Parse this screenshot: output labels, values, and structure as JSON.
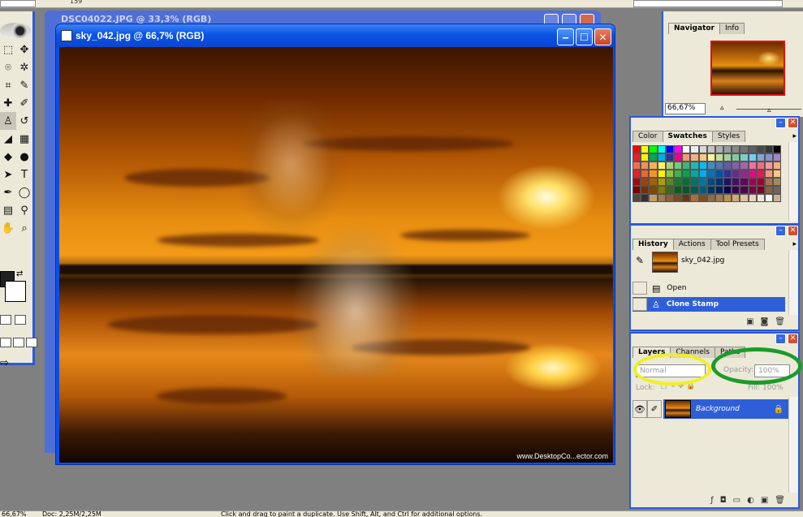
{
  "option_bar": {
    "value": "159"
  },
  "back_window": {
    "title": "DSC04022.JPG @ 33,3% (RGB)"
  },
  "document": {
    "title": "sky_042.jpg @ 66,7% (RGB)",
    "watermark": "www.DesktopCo...ector.com"
  },
  "navigator": {
    "tabs": [
      "Navigator",
      "Info"
    ],
    "zoom": "66,67%"
  },
  "color_panel": {
    "tabs": [
      "Color",
      "Swatches",
      "Styles"
    ],
    "active": "Swatches",
    "swatches": [
      "#ff0000",
      "#ffff00",
      "#00ff00",
      "#00ffff",
      "#0000ff",
      "#ff00ff",
      "#ffffff",
      "#ebebeb",
      "#d7d7d7",
      "#c3c3c3",
      "#afafaf",
      "#9b9b9b",
      "#878787",
      "#737373",
      "#5f5f5f",
      "#4b4b4b",
      "#373737",
      "#000000",
      "#ed1c24",
      "#fff200",
      "#00a651",
      "#00aeef",
      "#2e3192",
      "#ec008c",
      "#f7977a",
      "#f9ad81",
      "#fdc68a",
      "#fff79a",
      "#c4df9b",
      "#a3d39c",
      "#82ca9d",
      "#7bcdc8",
      "#6ecff6",
      "#7ea7d8",
      "#8493ca",
      "#a187be",
      "#f26c4f",
      "#f68e55",
      "#fbaf5c",
      "#fff467",
      "#acd372",
      "#7cc576",
      "#3bb878",
      "#1abbb4",
      "#00bff3",
      "#438ccb",
      "#5574b9",
      "#605ca8",
      "#855fa8",
      "#a763a8",
      "#f06ea9",
      "#f26d7d",
      "#f5989d",
      "#f9ad81",
      "#ed1c24",
      "#f26522",
      "#f7941d",
      "#fff200",
      "#8dc63f",
      "#39b54a",
      "#00a651",
      "#00a99d",
      "#00aeef",
      "#0072bc",
      "#0054a6",
      "#2e3192",
      "#662d91",
      "#92278f",
      "#ec008c",
      "#ed145b",
      "#f7977a",
      "#fdc68a",
      "#9e0b0f",
      "#a0410d",
      "#a36209",
      "#aba000",
      "#598527",
      "#1a7b30",
      "#007236",
      "#00746b",
      "#0076a3",
      "#004b80",
      "#003471",
      "#1b1464",
      "#440e62",
      "#630460",
      "#9e005d",
      "#9e0039",
      "#ab6f4f",
      "#a38a59",
      "#790000",
      "#7b2e00",
      "#7d4900",
      "#827b00",
      "#406618",
      "#005e20",
      "#005826",
      "#005952",
      "#005b7f",
      "#003663",
      "#002157",
      "#0d004c",
      "#32004b",
      "#4b0049",
      "#7b0046",
      "#7a0026",
      "#8c6239",
      "#736357",
      "#534741",
      "#362f2d",
      "#c69c6d",
      "#a67c52",
      "#8c6239",
      "#754c24",
      "#603913",
      "#a86e3c",
      "#7e4f22",
      "#8c6c48",
      "#9f7c52",
      "#b8924e",
      "#cfa978",
      "#dec3a0",
      "#e8d6bf",
      "#f2e8db",
      "#ffffff",
      "#c7b299"
    ]
  },
  "history": {
    "tabs": [
      "History",
      "Actions",
      "Tool Presets"
    ],
    "active": "History",
    "snapshot": "sky_042.jpg",
    "items": [
      {
        "label": "Open",
        "selected": false
      },
      {
        "label": "Clone Stamp",
        "selected": true
      }
    ]
  },
  "layers": {
    "tabs": [
      "Layers",
      "Channels",
      "Paths"
    ],
    "active": "Layers",
    "blend_mode": "Normal",
    "opacity_label": "Opacity:",
    "opacity_value": "100%",
    "lock_label": "Lock:",
    "fill_label": "Fill:",
    "fill_value": "100%",
    "layer_name": "Background"
  },
  "highlights": {
    "blend_color": "#f0f020",
    "opacity_color": "#1a9c2a"
  },
  "status": {
    "zoom": "66,67%",
    "doc": "Doc: 2,25M/2,25M",
    "hint": "Click and drag to paint a duplicate. Use Shift, Alt, and Ctrl for additional options."
  }
}
